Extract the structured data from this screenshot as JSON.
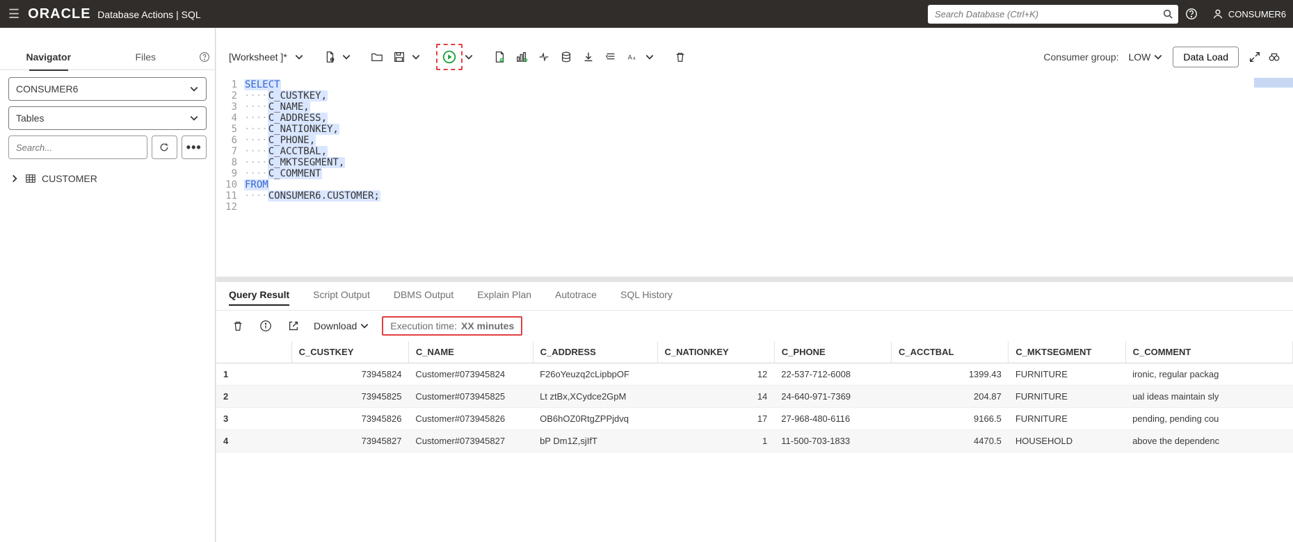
{
  "header": {
    "logo": "ORACLE",
    "product": "Database Actions",
    "section": "SQL",
    "search_placeholder": "Search Database (Ctrl+K)",
    "username": "CONSUMER6"
  },
  "sidebar": {
    "tabs": {
      "navigator": "Navigator",
      "files": "Files"
    },
    "schema_select": "CONSUMER6",
    "object_type_select": "Tables",
    "search_placeholder": "Search...",
    "tree_item": "CUSTOMER"
  },
  "toolbar": {
    "worksheet_label": "[Worksheet ]*",
    "consumer_group_label": "Consumer group:",
    "consumer_group_value": "LOW",
    "data_load": "Data Load"
  },
  "editor": {
    "lines": [
      {
        "n": 1,
        "text_a": "SELECT",
        "cls": "kw"
      },
      {
        "n": 2,
        "text_a": "    C_CUSTKEY,"
      },
      {
        "n": 3,
        "text_a": "    C_NAME,"
      },
      {
        "n": 4,
        "text_a": "    C_ADDRESS,"
      },
      {
        "n": 5,
        "text_a": "    C_NATIONKEY,"
      },
      {
        "n": 6,
        "text_a": "    C_PHONE,"
      },
      {
        "n": 7,
        "text_a": "    C_ACCTBAL,"
      },
      {
        "n": 8,
        "text_a": "    C_MKTSEGMENT,"
      },
      {
        "n": 9,
        "text_a": "    C_COMMENT"
      },
      {
        "n": 10,
        "text_a": "FROM",
        "cls": "kw"
      },
      {
        "n": 11,
        "text_a": "    CONSUMER6.CUSTOMER;"
      },
      {
        "n": 12,
        "text_a": ""
      }
    ]
  },
  "result_tabs": {
    "query_result": "Query Result",
    "script_output": "Script Output",
    "dbms_output": "DBMS Output",
    "explain_plan": "Explain Plan",
    "autotrace": "Autotrace",
    "sql_history": "SQL History"
  },
  "result_toolbar": {
    "download": "Download",
    "exec_label": "Execution time:",
    "exec_value": "XX minutes"
  },
  "grid": {
    "columns": [
      "C_CUSTKEY",
      "C_NAME",
      "C_ADDRESS",
      "C_NATIONKEY",
      "C_PHONE",
      "C_ACCTBAL",
      "C_MKTSEGMENT",
      "C_COMMENT"
    ],
    "rows": [
      {
        "n": "1",
        "custkey": "73945824",
        "name": "Customer#073945824",
        "addr": "F26oYeuzq2cLipbpOF",
        "nation": "12",
        "phone": "22-537-712-6008",
        "acctbal": "1399.43",
        "mkt": "FURNITURE",
        "comment": "ironic, regular packag"
      },
      {
        "n": "2",
        "custkey": "73945825",
        "name": "Customer#073945825",
        "addr": "Lt ztBx,XCydce2GpM",
        "nation": "14",
        "phone": "24-640-971-7369",
        "acctbal": "204.87",
        "mkt": "FURNITURE",
        "comment": "ual ideas maintain sly"
      },
      {
        "n": "3",
        "custkey": "73945826",
        "name": "Customer#073945826",
        "addr": "OB6hOZ0RtgZPPjdvq",
        "nation": "17",
        "phone": "27-968-480-6116",
        "acctbal": "9166.5",
        "mkt": "FURNITURE",
        "comment": "pending, pending cou"
      },
      {
        "n": "4",
        "custkey": "73945827",
        "name": "Customer#073945827",
        "addr": "bP Dm1Z,sjIfT",
        "nation": "1",
        "phone": "11-500-703-1833",
        "acctbal": "4470.5",
        "mkt": "HOUSEHOLD",
        "comment": "above the dependenc"
      }
    ]
  }
}
